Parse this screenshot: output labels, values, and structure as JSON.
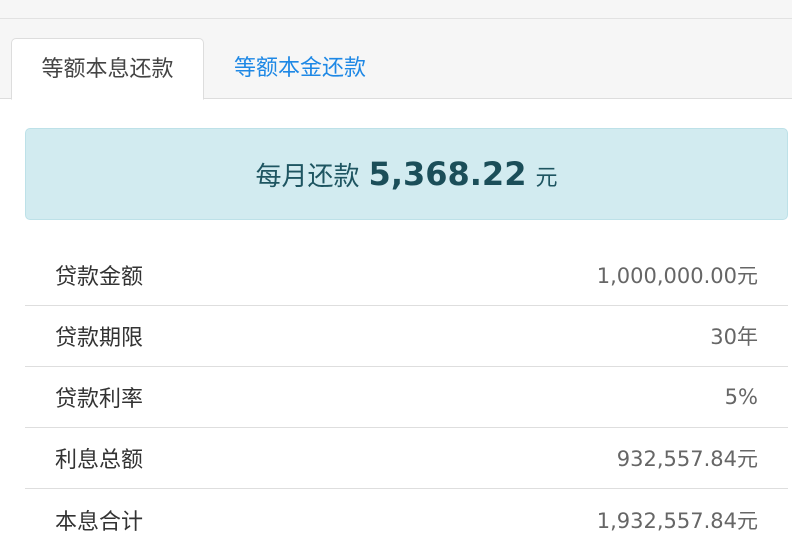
{
  "tabs": [
    {
      "label": "等额本息还款",
      "active": true
    },
    {
      "label": "等额本金还款",
      "active": false
    }
  ],
  "summary": {
    "label": "每月还款",
    "amount": "5,368.22",
    "unit": "元"
  },
  "details": [
    {
      "key": "贷款金额",
      "value": "1,000,000.00元"
    },
    {
      "key": "贷款期限",
      "value": "30年"
    },
    {
      "key": "贷款利率",
      "value": "5%"
    },
    {
      "key": "利息总额",
      "value": "932,557.84元"
    },
    {
      "key": "本息合计",
      "value": "1,932,557.84元"
    }
  ],
  "colors": {
    "accent": "#1e88e5",
    "alert_bg": "#d2ebf0",
    "alert_text": "#1e5561"
  }
}
